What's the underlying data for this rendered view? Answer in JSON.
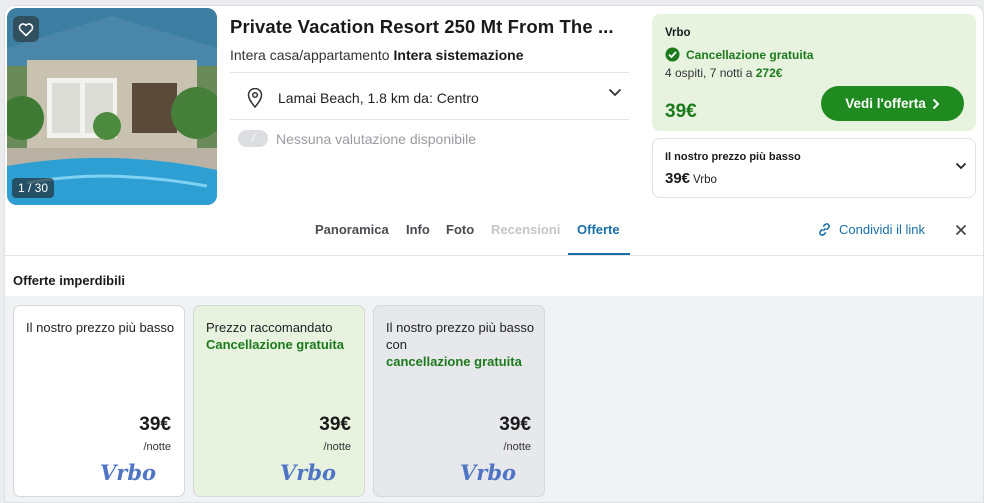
{
  "photo": {
    "counter": "1 / 30"
  },
  "listing": {
    "title": "Private Vacation Resort 250 Mt From The ...",
    "type_label": "Intera casa/appartamento",
    "type_value": "Intera sistemazione",
    "location": "Lamai Beach, 1.8 km da: Centro",
    "rating_badge": "/",
    "rating_text": "Nessuna valutazione disponibile"
  },
  "deal": {
    "provider": "Vrbo",
    "free_cancel": "Cancellazione gratuita",
    "stay_info": "4 ospiti, 7 notti a ",
    "stay_total": "272€",
    "price": "39€",
    "button": "Vedi l'offerta"
  },
  "lowest": {
    "label": "Il nostro prezzo più basso",
    "price": "39€",
    "provider": "Vrbo"
  },
  "tabs": [
    {
      "label": "Panoramica",
      "state": "normal"
    },
    {
      "label": "Info",
      "state": "normal"
    },
    {
      "label": "Foto",
      "state": "normal"
    },
    {
      "label": "Recensioni",
      "state": "disabled"
    },
    {
      "label": "Offerte",
      "state": "active"
    }
  ],
  "share_label": "Condividi il link",
  "offers_title": "Offerte imperdibili",
  "offers": [
    {
      "line1": "Il nostro prezzo più basso",
      "line2": "",
      "price": "39€",
      "per": "/notte",
      "provider": "Vrbo"
    },
    {
      "line1": "Prezzo raccomandato",
      "line2": "Cancellazione gratuita",
      "price": "39€",
      "per": "/notte",
      "provider": "Vrbo"
    },
    {
      "line1": "Il nostro prezzo più basso con",
      "line2": "cancellazione gratuita",
      "price": "39€",
      "per": "/notte",
      "provider": "Vrbo"
    }
  ],
  "colors": {
    "accent_green": "#1f8a1f",
    "deal_bg": "#e7f2df",
    "link_blue": "#1a6fa8"
  }
}
